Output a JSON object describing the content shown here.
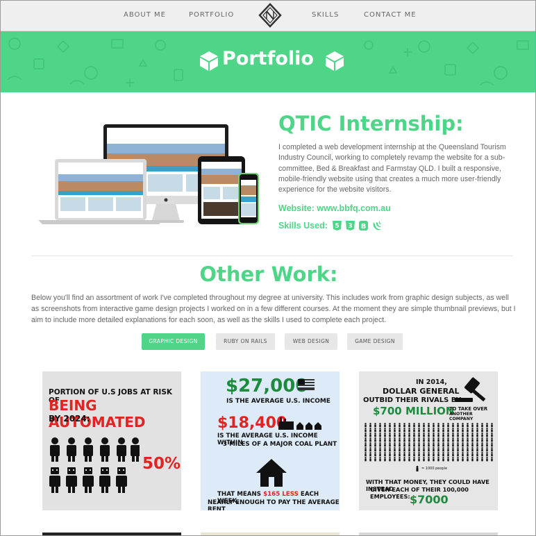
{
  "nav": {
    "about": "ABOUT ME",
    "portfolio": "PORTFOLIO",
    "skills": "SKILLS",
    "contact": "CONTACT ME"
  },
  "banner": {
    "title": "Portfolio"
  },
  "qtic": {
    "title": "QTIC Internship:",
    "description": "I completed a web development internship at the Queensland Tourism Industry Council, working to completely revamp the website for a sub-committee, Bed & Breakfast and Farmstay QLD. I built a responsive, mobile-friendly website using that creates a much more user-friendly experience for the website visitors.",
    "website_label": "Website:",
    "website_url": "www.bbfq.com.au",
    "skills_label": "Skills Used:",
    "skills_icons": [
      "html5-icon",
      "css3-icon",
      "bootstrap-icon",
      "jquery-icon"
    ]
  },
  "other": {
    "title": "Other Work:",
    "description": "Below you'll find an assortment of work I've completed throughout my degree at university. This includes work from graphic design subjects, as well as screenshots from interactive game design projects I worked on in a few different courses. At the moment they are simple thumbnail previews, but I aim to include more detailed explanations for each soon, as well as the skills I used to complete each project.",
    "filters": [
      "GRAPHIC DESIGN",
      "RUBY ON RAILS",
      "WEB DESIGN",
      "GAME DESIGN"
    ],
    "active_filter": "GRAPHIC DESIGN"
  },
  "cards": {
    "card1": {
      "line1": "PORTION OF U.S JOBS AT RISK OF",
      "line2": "BEING AUTOMATED",
      "line3": "BY 2024:",
      "percent": "50%"
    },
    "card2": {
      "amount1": "$27,000",
      "text1": "IS THE AVERAGE U.S. INCOME",
      "amount2": "$18,400",
      "text2a": "IS THE AVERAGE U.S. INCOME WITHIN",
      "text2b": "3 MILES OF A MAJOR COAL PLANT",
      "text3a_pre": "THAT MEANS ",
      "text3a_hl": "$165 LESS",
      "text3a_post": " EACH WEEK,",
      "text3b": "NEARLY ENOUGH TO PAY THE AVERAGE RENT"
    },
    "card3": {
      "line1": "IN 2014,",
      "line2": "DOLLAR GENERAL",
      "line3": "OUTBID THEIR RIVALS BY",
      "amount": "$700 MILLION",
      "side1": "TO TAKE OVER",
      "side2": "ANOTHER COMPANY",
      "legend": "= 1000 people",
      "text1": "WITH THAT MONEY, THEY COULD HAVE INSTEAD",
      "text2": "GIVEN EACH OF THEIR 100,000 EMPLOYEES:",
      "amount2": "$7000"
    }
  },
  "colors": {
    "accent": "#4fd587",
    "red": "#e02424",
    "green": "#1e8a3e",
    "nav_bg": "#efefef"
  }
}
